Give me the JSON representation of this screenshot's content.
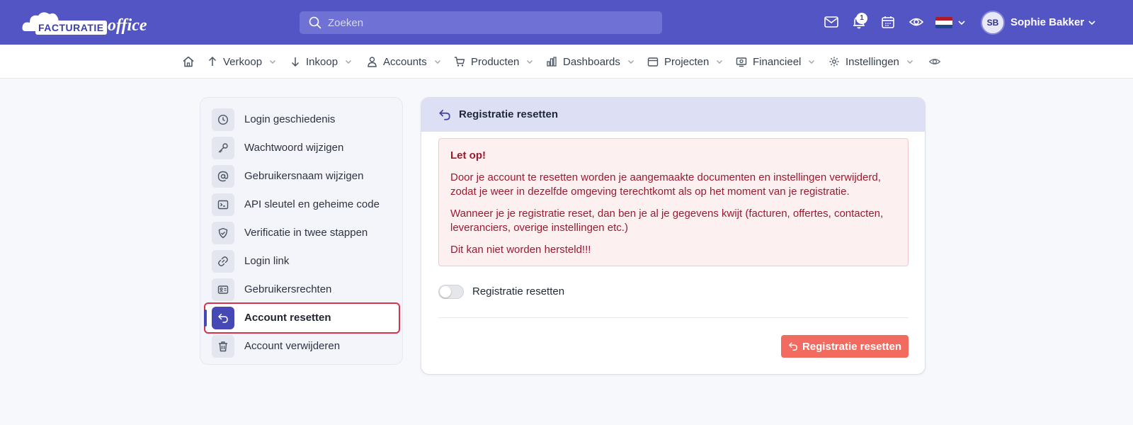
{
  "brand": {
    "logo_word1": "FACTURATIE",
    "logo_word2": "office",
    "primary_color": "#5355c4",
    "danger_color": "#f26b61"
  },
  "topbar": {
    "search_placeholder": "Zoeken",
    "notification_count": "1",
    "user_initials": "SB",
    "user_name": "Sophie Bakker",
    "icons": [
      "mail-icon",
      "bell-icon",
      "calendar-icon",
      "eye-icon",
      "flag-nl-icon",
      "chevron-down-icon"
    ]
  },
  "nav": {
    "items": [
      {
        "label": "Verkoop",
        "icon": "arrow-up-icon"
      },
      {
        "label": "Inkoop",
        "icon": "arrow-down-icon"
      },
      {
        "label": "Accounts",
        "icon": "user-icon"
      },
      {
        "label": "Producten",
        "icon": "cart-icon"
      },
      {
        "label": "Dashboards",
        "icon": "bar-chart-icon"
      },
      {
        "label": "Projecten",
        "icon": "folder-icon"
      },
      {
        "label": "Financieel",
        "icon": "money-icon"
      },
      {
        "label": "Instellingen",
        "icon": "gear-icon"
      }
    ]
  },
  "sidebar": {
    "items": [
      {
        "label": "Login geschiedenis",
        "icon": "clock-icon"
      },
      {
        "label": "Wachtwoord wijzigen",
        "icon": "key-icon"
      },
      {
        "label": "Gebruikersnaam wijzigen",
        "icon": "at-icon"
      },
      {
        "label": "API sleutel en geheime code",
        "icon": "terminal-icon"
      },
      {
        "label": "Verificatie in twee stappen",
        "icon": "shield-icon"
      },
      {
        "label": "Login link",
        "icon": "link-icon"
      },
      {
        "label": "Gebruikersrechten",
        "icon": "id-card-icon"
      },
      {
        "label": "Account resetten",
        "icon": "undo-icon",
        "active": true
      },
      {
        "label": "Account verwijderen",
        "icon": "trash-icon"
      }
    ]
  },
  "main": {
    "title": "Registratie resetten",
    "alert": {
      "title": "Let op!",
      "p1": "Door je account te resetten worden je aangemaakte documenten en instellingen verwijderd, zodat je weer in dezelfde omgeving terechtkomt als op het moment van je registratie.",
      "p2": "Wanneer je je registratie reset, dan ben je al je gegevens kwijt (facturen, offertes, contacten, leveranciers, overige instellingen etc.)",
      "p3": "Dit kan niet worden hersteld!!!"
    },
    "toggle_label": "Registratie resetten",
    "toggle_on": false,
    "button_label": "Registratie resetten"
  }
}
